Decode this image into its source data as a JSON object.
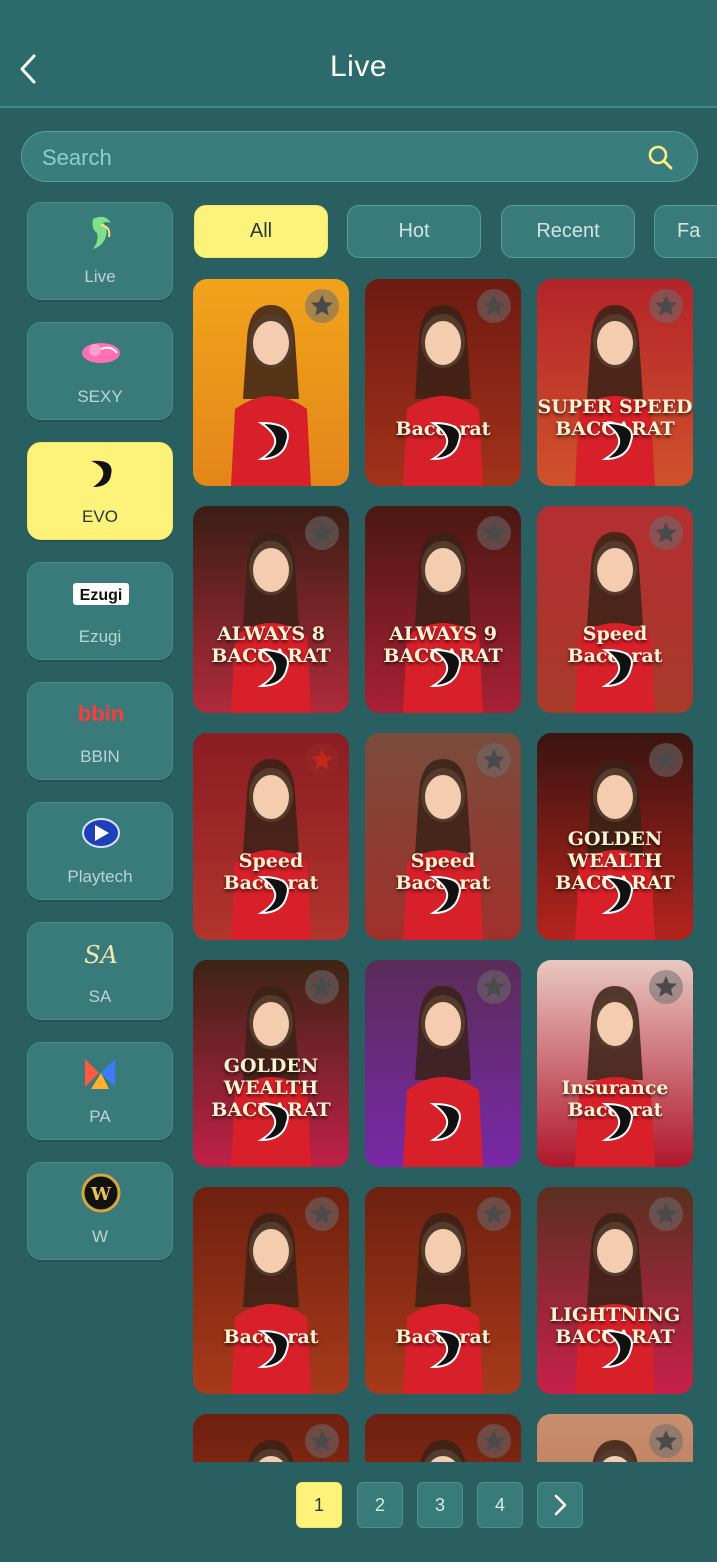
{
  "header": {
    "title": "Live"
  },
  "search": {
    "placeholder": "Search"
  },
  "sidebar": {
    "items": [
      {
        "label": "Live",
        "icon": "live-lady-icon"
      },
      {
        "label": "SEXY",
        "icon": "sexy-logo-icon"
      },
      {
        "label": "EVO",
        "icon": "evo-logo-icon",
        "active": true
      },
      {
        "label": "Ezugi",
        "icon": "ezugi-logo-icon",
        "logo_text": "Ezugi"
      },
      {
        "label": "BBIN",
        "icon": "bbin-logo-icon",
        "logo_text": "bbin"
      },
      {
        "label": "Playtech",
        "icon": "playtech-logo-icon"
      },
      {
        "label": "SA",
        "icon": "sa-logo-icon",
        "logo_text": "SA"
      },
      {
        "label": "PA",
        "icon": "pa-logo-icon"
      },
      {
        "label": "W",
        "icon": "w-logo-icon",
        "logo_text": "W"
      }
    ]
  },
  "tabs": [
    {
      "label": "All",
      "active": true
    },
    {
      "label": "Hot"
    },
    {
      "label": "Recent"
    },
    {
      "label": "Fa"
    }
  ],
  "games": [
    {
      "title": ""
    },
    {
      "title": "Baccarat"
    },
    {
      "title": "SUPER SPEED BACCARAT"
    },
    {
      "title": "ALWAYS 8 BACCARAT"
    },
    {
      "title": "ALWAYS 9 BACCARAT"
    },
    {
      "title": "Speed Baccarat"
    },
    {
      "title": "Speed Baccarat"
    },
    {
      "title": "Speed Baccarat"
    },
    {
      "title": "GOLDEN WEALTH BACCARAT"
    },
    {
      "title": "GOLDEN WEALTH BACCARAT"
    },
    {
      "title": ""
    },
    {
      "title": "Insurance Baccarat"
    },
    {
      "title": "Baccarat"
    },
    {
      "title": "Baccarat"
    },
    {
      "title": "LIGHTNING BACCARAT"
    },
    {
      "title": ""
    },
    {
      "title": ""
    },
    {
      "title": ""
    }
  ],
  "pagination": {
    "pages": [
      "1",
      "2",
      "3",
      "4"
    ],
    "current": "1"
  },
  "colors": {
    "background": "#2a5f62",
    "accent": "#fdf27a",
    "tile": "#397a7b"
  }
}
